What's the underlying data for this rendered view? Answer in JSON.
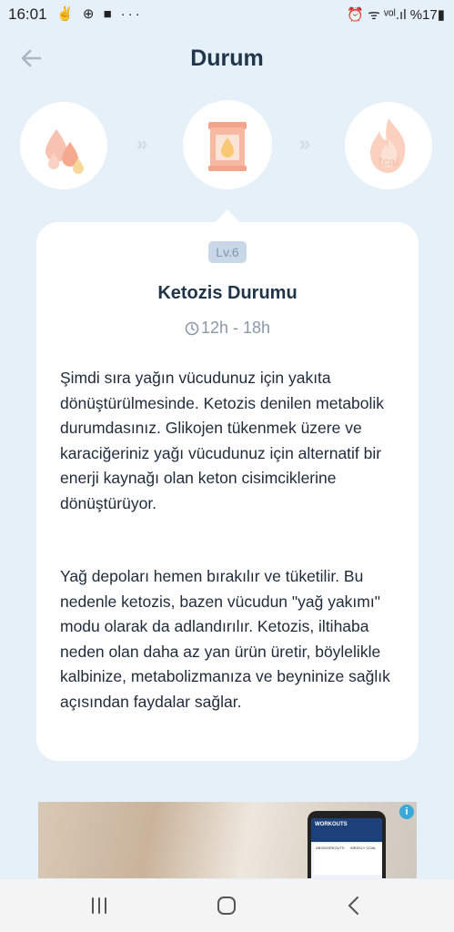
{
  "status_bar": {
    "time": "16:01",
    "notification_icons": "✌ ⊕ ■ ···",
    "system_icons": "⏰ ᯤ ᵛᵒˡ.ıl %17▮",
    "battery": "%17"
  },
  "header": {
    "title": "Durum"
  },
  "stages": {
    "stage_3_label": "fcal"
  },
  "card": {
    "level": "Lv.6",
    "title": "Ketozis Durumu",
    "duration": "12h - 18h",
    "paragraph_1": "Şimdi sıra yağın vücudunuz için yakıta dönüştürülmesinde. Ketozis denilen metabolik durumdasınız. Glikojen tükenmek üzere ve karaciğeriniz yağı vücudunuz için alternatif bir enerji kaynağı olan keton cisimciklerine dönüştürüyor.",
    "paragraph_2": "Yağ depoları hemen bırakılır ve tüketilir. Bu nedenle ketozis, bazen vücudun \"yağ yakımı\" modu olarak da adlandırılır. Ketozis, iltihaba neden olan daha az yan ürün üretir, böylelikle kalbinize, metabolizmanıza ve beyninize sağlık açısından faydalar sağlar."
  },
  "ad": {
    "info": "i",
    "phone_header": "WORKOUTS",
    "tile_1": "ABSWORKOUTS",
    "tile_2": "WEEKLY GOAL"
  },
  "colors": {
    "background": "#e6f0f8",
    "card": "#ffffff",
    "title": "#20364a",
    "stage_icon": "#f5a483",
    "muted": "#8a98a6"
  },
  "icons": {
    "back": "arrow-left-icon",
    "stage_1": "blood-drops-icon",
    "stage_2": "fat-jar-icon",
    "stage_3": "flame-kcal-icon",
    "duration": "clock-icon"
  }
}
